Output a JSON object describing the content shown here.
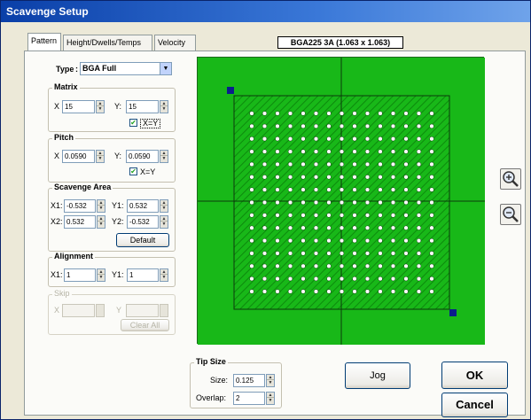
{
  "window": {
    "title": "Scavenge Setup"
  },
  "tabs": [
    {
      "label": "Pattern",
      "active": true
    },
    {
      "label": "Height/Dwells/Temps",
      "active": false
    },
    {
      "label": "Velocity",
      "active": false
    }
  ],
  "package_label": "BGA225 3A (1.063 x 1.063)",
  "type": {
    "label": "Type",
    "value": "BGA Full"
  },
  "matrix": {
    "title": "Matrix",
    "x_label": "X",
    "x_value": "15",
    "y_label": "Y:",
    "y_value": "15",
    "link_label": "X=Y",
    "link_checked": true
  },
  "pitch": {
    "title": "Pitch",
    "x_label": "X",
    "x_value": "0.0590",
    "y_label": "Y:",
    "y_value": "0.0590",
    "link_label": "X=Y",
    "link_checked": true
  },
  "scavenge_area": {
    "title": "Scavenge Area",
    "x1_label": "X1:",
    "x1_value": "-0.532",
    "y1_label": "Y1:",
    "y1_value": "0.532",
    "x2_label": "X2:",
    "x2_value": "0.532",
    "y2_label": "Y2:",
    "y2_value": "-0.532",
    "default_label": "Default"
  },
  "alignment": {
    "title": "Alignment",
    "x1_label": "X1:",
    "x1_value": "1",
    "y1_label": "Y1:",
    "y1_value": "1"
  },
  "skip": {
    "title": "Skip",
    "x_label": "X",
    "x_value": "",
    "y_label": "Y",
    "y_value": "",
    "clear_label": "Clear All"
  },
  "tip_size": {
    "title": "Tip Size",
    "size_label": "Size:",
    "size_value": "0.125",
    "overlap_label": "Overlap:",
    "overlap_value": "2"
  },
  "buttons": {
    "jog": "Jog",
    "ok": "OK",
    "cancel": "Cancel"
  },
  "preview": {
    "background_color": "#18b818",
    "hatch_color": "#0c8f0c",
    "ball_rows": 15,
    "ball_cols": 15,
    "ball_color": "#ffffff"
  },
  "icons": {
    "zoom_in": "zoom-in-icon",
    "zoom_out": "zoom-out-icon"
  }
}
